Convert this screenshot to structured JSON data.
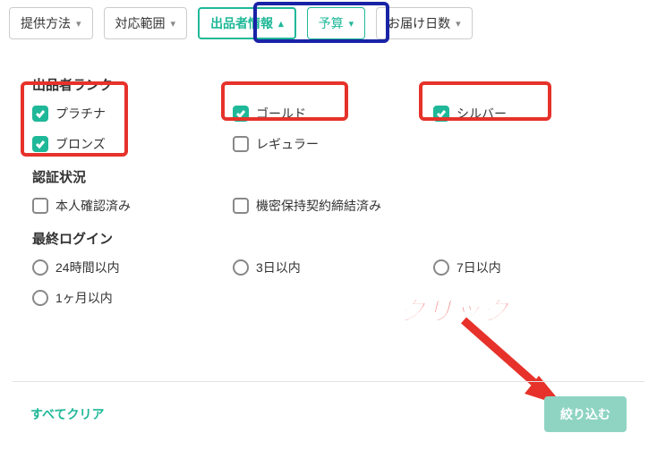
{
  "filters": {
    "method": {
      "label": "提供方法"
    },
    "scope": {
      "label": "対応範囲"
    },
    "seller": {
      "label": "出品者情報"
    },
    "budget": {
      "label": "予算"
    },
    "delivery": {
      "label": "お届け日数"
    }
  },
  "panel": {
    "rank": {
      "title": "出品者ランク",
      "platinum": "プラチナ",
      "gold": "ゴールド",
      "silver": "シルバー",
      "bronze": "ブロンズ",
      "regular": "レギュラー"
    },
    "verify": {
      "title": "認証状況",
      "identity": "本人確認済み",
      "nda": "機密保持契約締結済み"
    },
    "login": {
      "title": "最終ログイン",
      "h24": "24時間以内",
      "d3": "3日以内",
      "d7": "7日以内",
      "m1": "1ヶ月以内"
    }
  },
  "footer": {
    "clear": "すべてクリア",
    "apply": "絞り込む"
  },
  "annotation": {
    "click": "クリック"
  }
}
